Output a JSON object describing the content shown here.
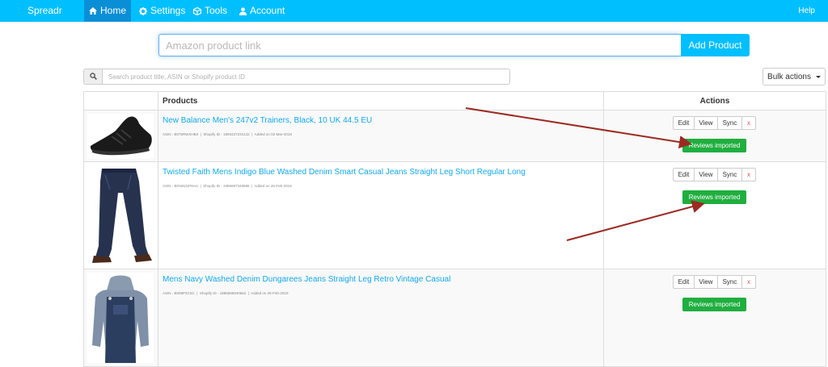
{
  "navbar": {
    "brand": "Spreadr",
    "items": [
      {
        "label": "Home",
        "icon": "home-icon"
      },
      {
        "label": "Settings",
        "icon": "gear-icon"
      },
      {
        "label": "Tools",
        "icon": "cube-icon"
      },
      {
        "label": "Account",
        "icon": "user-icon"
      }
    ],
    "help": "Help"
  },
  "add_product": {
    "placeholder": "Amazon product link",
    "button_label": "Add Product"
  },
  "search": {
    "placeholder": "Search product title, ASIN or Shopify product ID",
    "icon": "search-icon"
  },
  "bulk_actions": {
    "label": "Bulk actions"
  },
  "table": {
    "headers": {
      "products": "Products",
      "actions": "Actions"
    },
    "action_labels": {
      "edit": "Edit",
      "view": "View",
      "sync": "Sync",
      "remove": "x",
      "reviews": "Reviews imported"
    },
    "rows": [
      {
        "title": "New Balance Men's 247v2 Trainers, Black, 10 UK 44.5 EU",
        "asin": "ASIN - B075RWXHB3",
        "shopify_id": "Shopify ID - 1993437234132",
        "added": "Added on 02-Mar-2019"
      },
      {
        "title": "Twisted Faith Mens Indigo Blue Washed Denim Smart Casual Jeans Straight Leg Short Regular Long",
        "asin": "ASIN - B01M1GP6AU",
        "shopify_id": "Shopify ID - 1985697349686",
        "added": "Added on 26-Feb-2019"
      },
      {
        "title": "Mens Navy Washed Denim Dungarees Jeans Straight Leg Retro Vintage Casual",
        "asin": "ASIN - B008PZC5C",
        "shopify_id": "Shopify ID - 1985695940662",
        "added": "Added on 26-Feb-2019"
      }
    ]
  },
  "colors": {
    "navbar": "#00bfff",
    "nav_active": "#0a8fd6",
    "link": "#12a8ea",
    "reviews_button": "#1fae3f",
    "arrow": "#9b2a22"
  }
}
